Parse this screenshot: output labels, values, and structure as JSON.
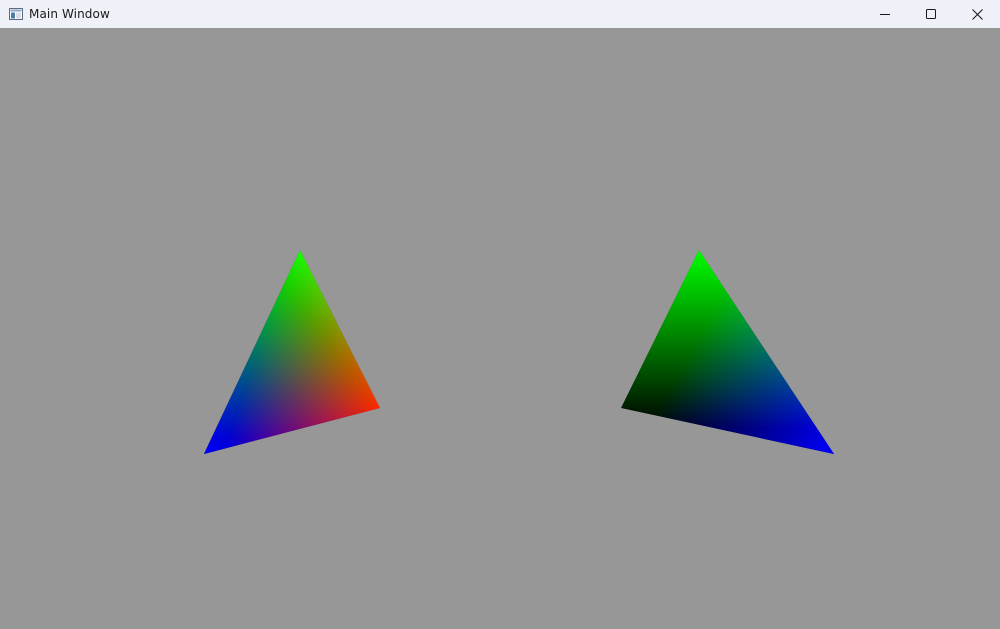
{
  "window": {
    "title": "Main Window",
    "icon": "app-window-icon",
    "background": "#979797",
    "titlebar_background": "#eff1f8"
  },
  "caption_buttons": {
    "minimize": "minimize-icon",
    "maximize": "maximize-icon",
    "close": "close-icon"
  },
  "scene": {
    "left_triangle": {
      "vertex_colors": [
        "#00ff00",
        "#0000ff",
        "#ff0000"
      ]
    },
    "right_triangle": {
      "vertex_colors": [
        "#00ff00",
        "#000000",
        "#0000ff"
      ]
    }
  }
}
